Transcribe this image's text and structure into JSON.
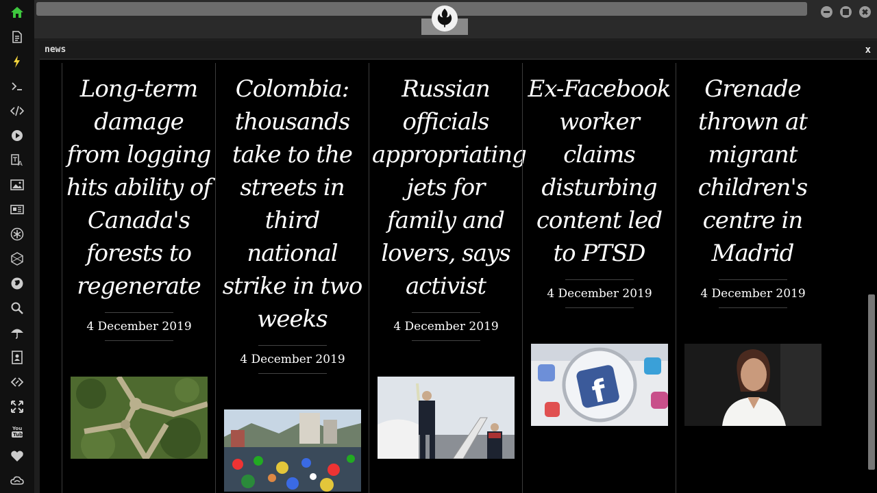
{
  "panel": {
    "title": "news",
    "close_label": "x"
  },
  "articles": [
    {
      "title": "Long-term damage from logging hits ability of Canada's forests to regenerate",
      "date": "4 December 2019",
      "image": "aerial-forest-clearing"
    },
    {
      "title": "Colombia: thousands take to the streets in third national strike in two weeks",
      "date": "4 December 2019",
      "image": "crowd-with-flags"
    },
    {
      "title": "Russian officials appropriating jets for family and lovers, says activist",
      "date": "4 December 2019",
      "image": "officials-on-jet-stairs"
    },
    {
      "title": "Ex-Facebook worker claims disturbing content led to PTSD",
      "date": "4 December 2019",
      "image": "facebook-logo-magnifier"
    },
    {
      "title": "Grenade thrown at migrant children's centre in Madrid",
      "date": "4 December 2019",
      "image": "woman-speaker-rtve"
    }
  ],
  "sidebar_icons": [
    "home-icon",
    "document-icon",
    "lightning-icon",
    "terminal-icon",
    "code-icon",
    "play-icon",
    "translate-icon",
    "image-icon",
    "news-icon",
    "asterisk-icon",
    "hexagon-icon",
    "globe-icon",
    "search-icon",
    "umbrella-icon",
    "contacts-icon",
    "link-icon",
    "expand-icon",
    "youtube-icon",
    "heart-icon",
    "cloud-icon"
  ],
  "colors": {
    "accent_green": "#3ec73e",
    "accent_yellow": "#f2d33b",
    "background": "#000000"
  }
}
